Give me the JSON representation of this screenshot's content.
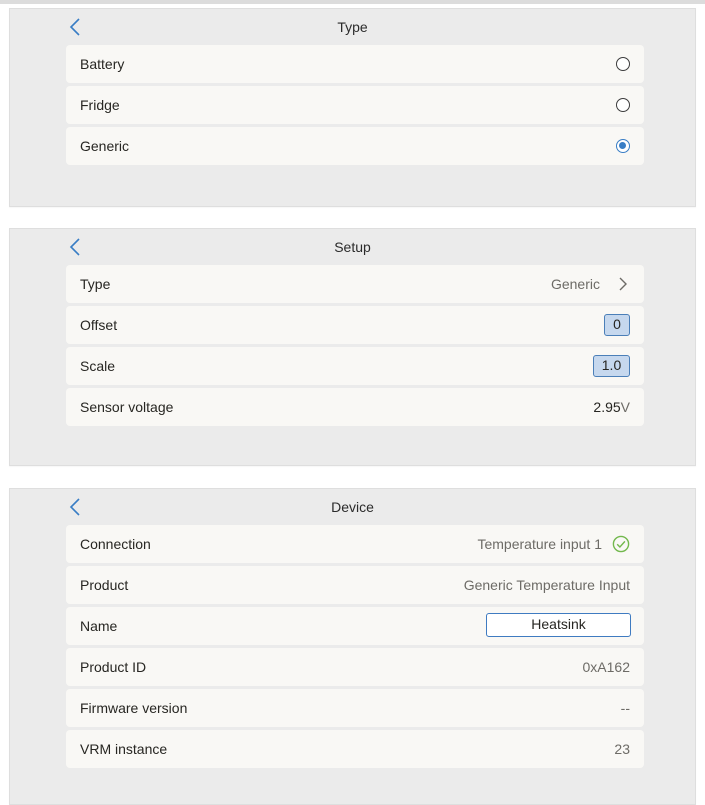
{
  "type_panel": {
    "title": "Type",
    "options": [
      {
        "label": "Battery",
        "selected": false
      },
      {
        "label": "Fridge",
        "selected": false
      },
      {
        "label": "Generic",
        "selected": true
      }
    ]
  },
  "setup_panel": {
    "title": "Setup",
    "type_label": "Type",
    "type_value": "Generic",
    "offset_label": "Offset",
    "offset_value": "0",
    "scale_label": "Scale",
    "scale_value": "1.0",
    "sensor_voltage_label": "Sensor voltage",
    "sensor_voltage_value": "2.95",
    "sensor_voltage_unit": "V"
  },
  "device_panel": {
    "title": "Device",
    "connection_label": "Connection",
    "connection_value": "Temperature input 1",
    "product_label": "Product",
    "product_value": "Generic Temperature Input",
    "name_label": "Name",
    "name_value": "Heatsink",
    "product_id_label": "Product ID",
    "product_id_value": "0xA162",
    "firmware_label": "Firmware version",
    "firmware_value": "--",
    "vrm_label": "VRM instance",
    "vrm_value": "23"
  },
  "colors": {
    "accent": "#387dc5",
    "panel_bg": "#ebebeb",
    "row_bg": "#f9f8f5",
    "ok_green": "#72b84c"
  },
  "icons": [
    "back-chevron-icon",
    "chevron-right-icon",
    "radio-icon",
    "check-circle-icon"
  ]
}
